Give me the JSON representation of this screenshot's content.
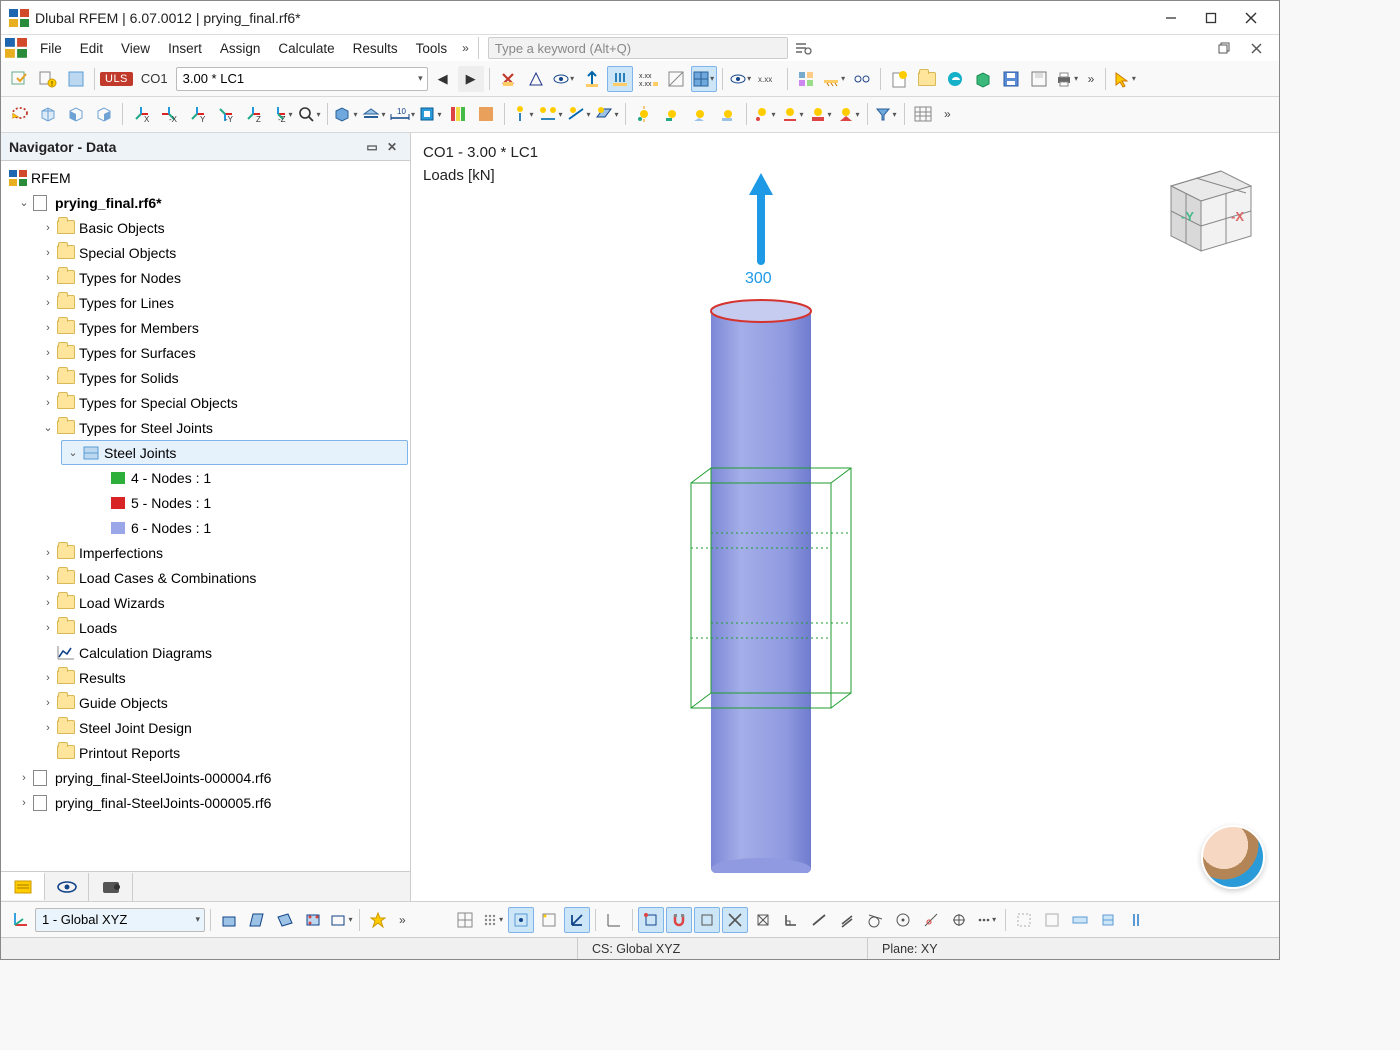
{
  "app": {
    "vendor": "Dlubal",
    "name": "RFEM",
    "version": "6.07.0012",
    "document": "prying_final.rf6*",
    "title_full": "Dlubal RFEM | 6.07.0012 | prying_final.rf6*"
  },
  "menu": {
    "items": [
      "File",
      "Edit",
      "View",
      "Insert",
      "Assign",
      "Calculate",
      "Results",
      "Tools"
    ],
    "search_placeholder": "Type a keyword (Alt+Q)"
  },
  "toolbar1": {
    "uls_badge": "ULS",
    "load_case": "CO1",
    "load_factor": "3.00 * LC1"
  },
  "navigator": {
    "title": "Navigator - Data",
    "root": "RFEM",
    "model": "prying_final.rf6*",
    "nodes": [
      {
        "label": "Basic Objects",
        "exp": ">"
      },
      {
        "label": "Special Objects",
        "exp": ">"
      },
      {
        "label": "Types for Nodes",
        "exp": ">"
      },
      {
        "label": "Types for Lines",
        "exp": ">"
      },
      {
        "label": "Types for Members",
        "exp": ">"
      },
      {
        "label": "Types for Surfaces",
        "exp": ">"
      },
      {
        "label": "Types for Solids",
        "exp": ">"
      },
      {
        "label": "Types for Special Objects",
        "exp": ">"
      },
      {
        "label": "Types for Steel Joints",
        "exp": "v",
        "children": [
          {
            "label": "Steel Joints",
            "selected": true,
            "exp": "v",
            "children": [
              {
                "label": "4 - Nodes : 1",
                "color": "#2eae3a"
              },
              {
                "label": "5 - Nodes : 1",
                "color": "#d82424"
              },
              {
                "label": "6 - Nodes : 1",
                "color": "#9ba6e8"
              }
            ]
          }
        ]
      },
      {
        "label": "Imperfections",
        "exp": ">"
      },
      {
        "label": "Load Cases & Combinations",
        "exp": ">"
      },
      {
        "label": "Load Wizards",
        "exp": ">"
      },
      {
        "label": "Loads",
        "exp": ">"
      },
      {
        "label": "Calculation Diagrams",
        "icon": "diagram"
      },
      {
        "label": "Results",
        "exp": ">"
      },
      {
        "label": "Guide Objects",
        "exp": ">"
      },
      {
        "label": "Steel Joint Design",
        "exp": ">"
      },
      {
        "label": "Printout Reports"
      }
    ],
    "siblings": [
      "prying_final-SteelJoints-000004.rf6",
      "prying_final-SteelJoints-000005.rf6"
    ]
  },
  "viewport": {
    "line1": "CO1 - 3.00 * LC1",
    "line2": "Loads [kN]",
    "load_value": "300"
  },
  "bottom": {
    "cs_combo": "1 - Global XYZ"
  },
  "status": {
    "cs": "CS: Global XYZ",
    "plane": "Plane: XY"
  }
}
